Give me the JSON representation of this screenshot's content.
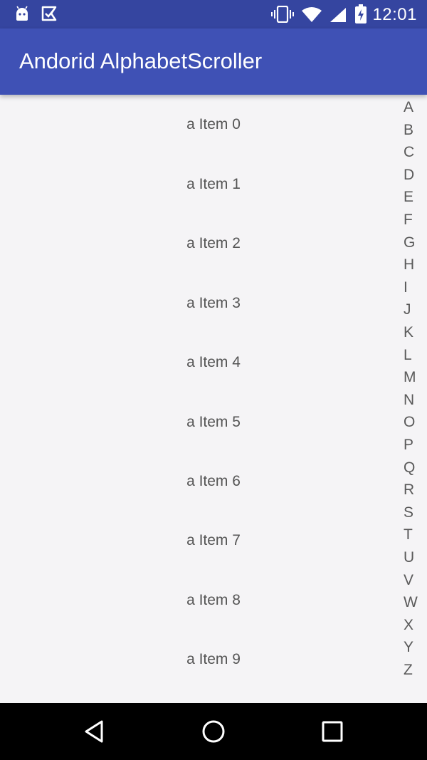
{
  "status_bar": {
    "time": "12:01",
    "left_icons": [
      "android-icon",
      "play-store-icon"
    ],
    "right_icons": [
      "vibrate-icon",
      "wifi-icon",
      "battery-charging-icon"
    ],
    "color": "#3545a0"
  },
  "app_bar": {
    "title": "Andorid AlphabetScroller",
    "color": "#3f51b5"
  },
  "list": {
    "items": [
      {
        "label": "a Item 0"
      },
      {
        "label": "a Item 1"
      },
      {
        "label": "a Item 2"
      },
      {
        "label": "a Item 3"
      },
      {
        "label": "a Item 4"
      },
      {
        "label": "a Item 5"
      },
      {
        "label": "a Item 6"
      },
      {
        "label": "a Item 7"
      },
      {
        "label": "a Item 8"
      },
      {
        "label": "a Item 9"
      }
    ]
  },
  "alphabet_scroller": {
    "letters": [
      "A",
      "B",
      "C",
      "D",
      "E",
      "F",
      "G",
      "H",
      "I",
      "J",
      "K",
      "L",
      "M",
      "N",
      "O",
      "P",
      "Q",
      "R",
      "S",
      "T",
      "U",
      "V",
      "W",
      "X",
      "Y",
      "Z"
    ]
  },
  "nav_bar": {
    "buttons": [
      "back-icon",
      "home-icon",
      "recents-icon"
    ]
  }
}
